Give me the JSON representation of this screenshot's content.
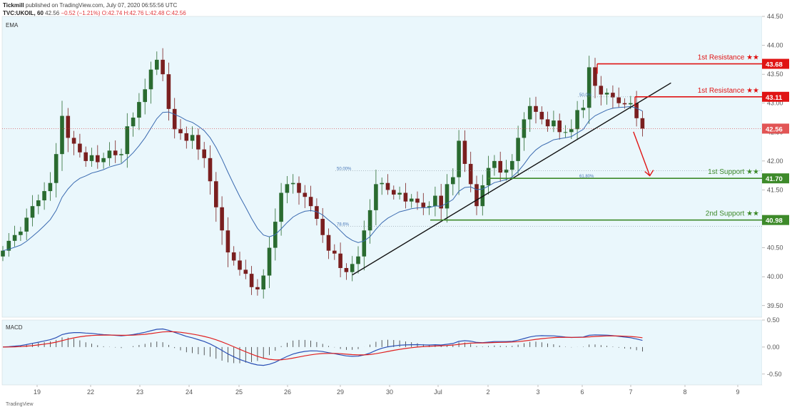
{
  "header": {
    "publisher": "Tickmill",
    "published_text": "published on TradingView.com, July 07, 2020 06:55:56 UTC",
    "symbol": "TVC:UKOIL, 60",
    "last": "42.56",
    "change": "−0.52 (−1.21%)",
    "ohlc": "O:42.74 H:42.76 L:42.48 C:42.56"
  },
  "indicator_label": "EMA",
  "macd_label": "MACD",
  "footer_logo": "TradingView",
  "colors": {
    "bg": "#eaf7fc",
    "up": "#2a6b30",
    "down": "#7a1f1f",
    "ema": "#3a6ab0",
    "resistance": "#e01414",
    "support": "#3d8a2a",
    "trend": "#111111",
    "macd": "#2a4fb5",
    "signal": "#e02020"
  },
  "chart_data": {
    "type": "candlestick",
    "symbol": "TVC:UKOIL, 60",
    "ylim": [
      39.3,
      44.5
    ],
    "y_ticks": [
      "44.50",
      "44.00",
      "43.50",
      "43.00",
      "42.50",
      "42.00",
      "41.50",
      "41.00",
      "40.50",
      "40.00",
      "39.50"
    ],
    "x_ticks": [
      "19",
      "22",
      "23",
      "24",
      "25",
      "26",
      "29",
      "30",
      "Jul",
      "2",
      "3",
      "6",
      "7",
      "8",
      "9"
    ],
    "macd_ylim": [
      -0.7,
      0.5
    ],
    "macd_ticks": [
      "0.50",
      "0.00",
      "-0.50"
    ],
    "closes": [
      40.45,
      40.62,
      40.72,
      40.78,
      41.02,
      41.22,
      41.32,
      41.48,
      41.62,
      42.12,
      42.78,
      42.4,
      42.3,
      42.15,
      42.0,
      42.1,
      41.98,
      42.05,
      42.18,
      42.1,
      42.12,
      42.6,
      42.75,
      43.02,
      43.24,
      43.58,
      43.75,
      43.5,
      42.9,
      42.55,
      42.48,
      42.35,
      42.45,
      42.2,
      42.05,
      41.65,
      41.2,
      40.8,
      40.42,
      40.28,
      40.12,
      40.05,
      39.82,
      39.78,
      40.02,
      40.5,
      40.95,
      41.45,
      41.6,
      41.62,
      41.45,
      41.38,
      41.22,
      41.0,
      40.72,
      40.45,
      40.4,
      40.15,
      40.08,
      40.22,
      40.35,
      40.8,
      41.15,
      41.6,
      41.62,
      41.5,
      41.42,
      41.45,
      41.3,
      41.35,
      41.28,
      41.2,
      41.22,
      41.4,
      41.18,
      41.6,
      41.72,
      42.35,
      41.95,
      41.6,
      41.22,
      41.58,
      41.88,
      42.0,
      41.8,
      41.85,
      42.0,
      42.4,
      42.72,
      42.95,
      42.85,
      42.72,
      42.6,
      42.7,
      42.5,
      42.5,
      42.55,
      42.88,
      42.92,
      43.62,
      43.3,
      43.15,
      43.18,
      43.1,
      43.0,
      42.98,
      43.0,
      42.74,
      42.56
    ],
    "ema_label": "EMA",
    "levels": [
      {
        "label": "1st Resistance ★★",
        "price": "43.68",
        "value": 43.68,
        "kind": "resistance"
      },
      {
        "label": "1st Resistance ★★",
        "price": "43.11",
        "value": 43.11,
        "kind": "resistance"
      },
      {
        "label": "",
        "price": "42.56",
        "value": 42.56,
        "kind": "last"
      },
      {
        "label": "1st Support ★★",
        "price": "41.70",
        "value": 41.7,
        "kind": "support"
      },
      {
        "label": "2nd Support ★★",
        "price": "40.98",
        "value": 40.98,
        "kind": "support"
      }
    ],
    "fib_labels": [
      {
        "text": "50.0%",
        "value": 43.11
      },
      {
        "text": "50.00%",
        "value": 41.83
      },
      {
        "text": "61.80%",
        "value": 41.7
      },
      {
        "text": "78.6%",
        "value": 40.87
      }
    ],
    "trendline": {
      "start": [
        59,
        40.03
      ],
      "end": [
        108,
        43.35
      ]
    },
    "projection_arrow": {
      "from": [
        106,
        42.48
      ],
      "to": [
        109,
        41.72
      ]
    }
  }
}
